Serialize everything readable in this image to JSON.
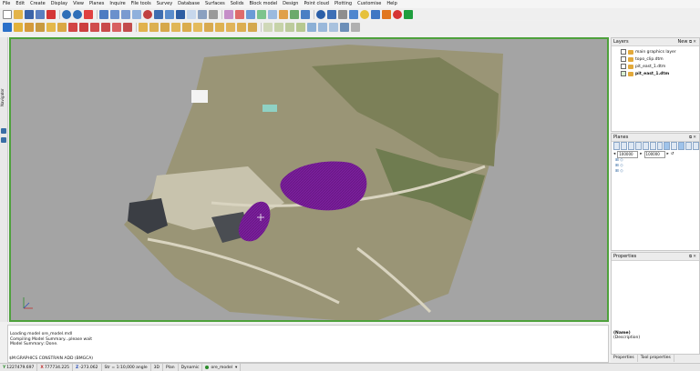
{
  "menu": [
    "File",
    "Edit",
    "Create",
    "Display",
    "View",
    "Planes",
    "Inquire",
    "File tools",
    "Survey",
    "Database",
    "Surfaces",
    "Solids",
    "Block model",
    "Design",
    "Point cloud",
    "Plotting",
    "Customise",
    "Help"
  ],
  "navigator": {
    "label": "Navigator"
  },
  "layers": {
    "title": "Layers",
    "new_label": "New",
    "items": [
      "main graphics layer",
      "topo_clip.dtm",
      "pit_east_1.dtm",
      "pit_east_1.dtm"
    ]
  },
  "planes": {
    "title": "Planes",
    "value1": "100000",
    "value2": "100000"
  },
  "properties": {
    "title": "Properties",
    "name_label": "(Name)",
    "description_label": "(Description)",
    "tab1": "Properties",
    "tab2": "Tool properties"
  },
  "console": {
    "lines": [
      "Loading model ore_model.mdl",
      "Compiling Model Summary...please wait",
      "Model Summary: Done."
    ],
    "command": "$M:GRAPHICS CONSTRAIN ADD (BMGCA)"
  },
  "status": {
    "y_label": "Y",
    "y": "1227479.697",
    "x_label": "X",
    "x": "777734.225",
    "z_label": "Z",
    "z": "-273.062",
    "scale": "Str = 1:10,000 angle",
    "mode3d": "3D",
    "plan": "Plan",
    "dynamic": "Dynamic",
    "model": "ore_model"
  },
  "colors": {
    "selection_border": "#4ea13c",
    "ore_body": "#7a1f9b",
    "viewport_bg": "#a4a4a4"
  }
}
